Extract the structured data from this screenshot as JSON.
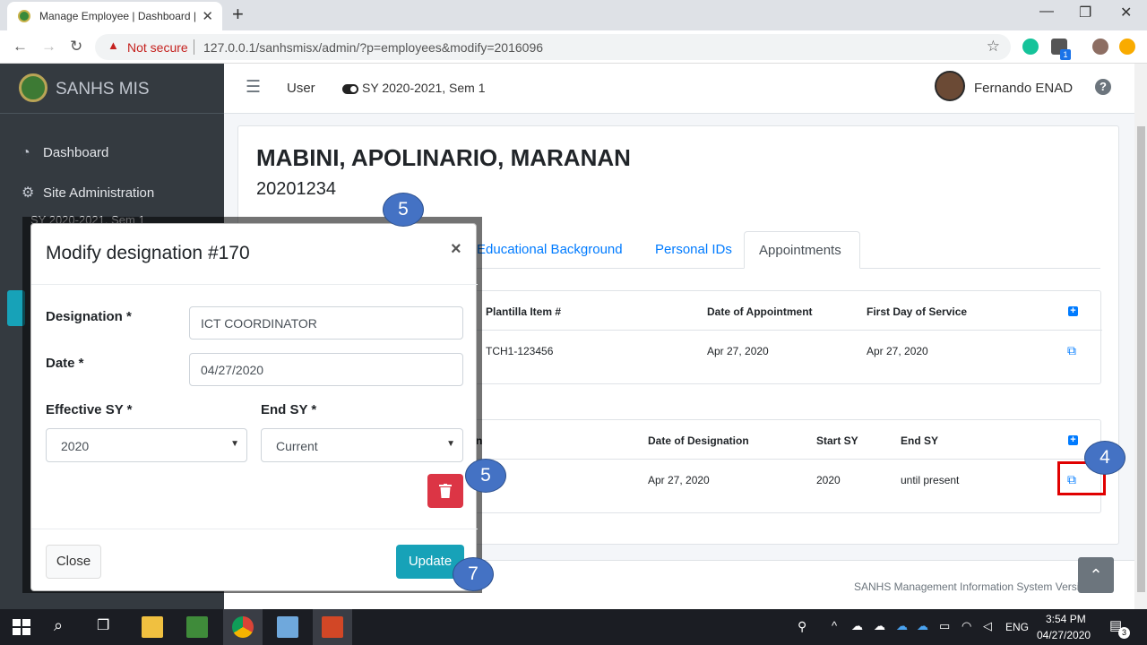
{
  "browser": {
    "tab_title": "Manage Employee | Dashboard |",
    "new_tab": "+",
    "not_secure": "Not secure",
    "url": "127.0.0.1/sanhsmisx/admin/?p=employees&modify=2016096",
    "ext_badge": "1"
  },
  "sidebar": {
    "brand": "SANHS MIS",
    "items": [
      {
        "label": "Dashboard",
        "icon": "tachometer-icon"
      },
      {
        "label": "Site Administration",
        "icon": "cogs-icon"
      }
    ],
    "sy_partial": "SY 2020-2021, Sem 1"
  },
  "topnav": {
    "user_label": "User",
    "sy_label": "SY 2020-2021, Sem 1",
    "user_name": "Fernando ENAD"
  },
  "employee": {
    "name": "MABINI, APOLINARIO, MARANAN",
    "id": "20201234"
  },
  "tabs": [
    {
      "label": "Educational Background"
    },
    {
      "label": "Personal IDs"
    },
    {
      "label": "Appointments"
    }
  ],
  "appointments": {
    "headers": [
      "Plantilla Item #",
      "Date of Appointment",
      "First Day of Service"
    ],
    "row": [
      "TCH1-123456",
      "Apr 27, 2020",
      "Apr 27, 2020"
    ]
  },
  "designations": {
    "headers": [
      "n",
      "Date of Designation",
      "Start SY",
      "End SY"
    ],
    "row": [
      "Apr 27, 2020",
      "2020",
      "until present"
    ]
  },
  "modal": {
    "title": "Modify designation #170",
    "designation_label": "Designation *",
    "designation_value": "ICT COORDINATOR",
    "date_label": "Date *",
    "date_value": "04/27/2020",
    "effective_sy_label": "Effective SY *",
    "effective_sy_value": "2020",
    "end_sy_label": "End SY *",
    "end_sy_value": "Current",
    "close_label": "Close",
    "update_label": "Update"
  },
  "footer": {
    "text": "SANHS Management Information System Versio"
  },
  "steps": {
    "top": "5",
    "delete": "5",
    "edit": "4",
    "update": "7"
  },
  "taskbar": {
    "lang": "ENG",
    "time": "3:54 PM",
    "date": "04/27/2020",
    "notif": "3"
  },
  "colors": {
    "primary": "#007bff",
    "sidebar": "#343a40",
    "danger": "#dc3545",
    "info": "#17a2b8",
    "step": "#4472c4"
  }
}
